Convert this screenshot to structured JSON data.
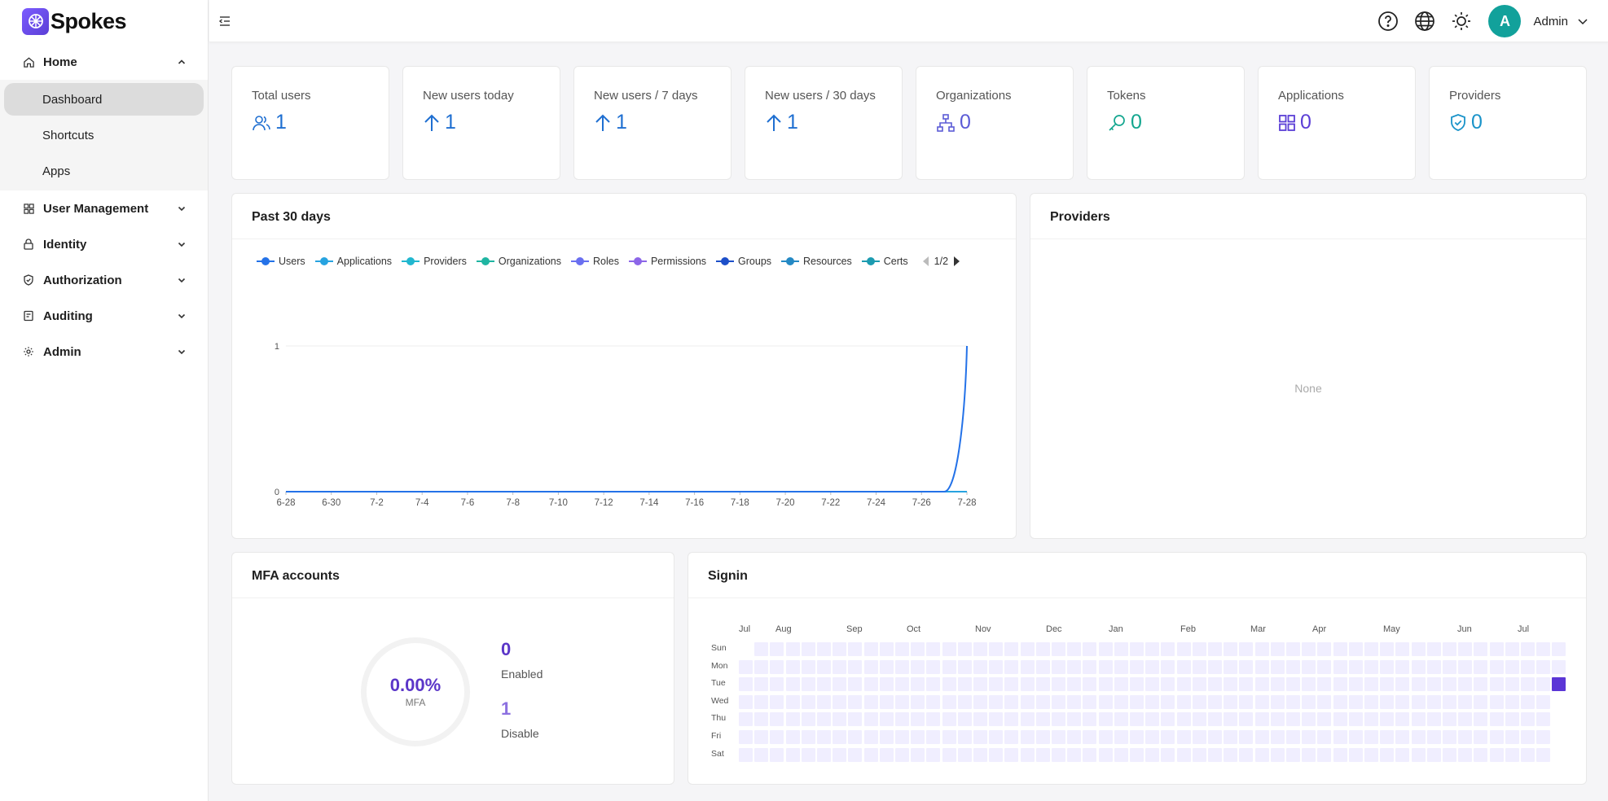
{
  "app": {
    "name": "Spokes"
  },
  "sidebar": {
    "home": {
      "label": "Home",
      "items": [
        {
          "label": "Dashboard",
          "active": true
        },
        {
          "label": "Shortcuts"
        },
        {
          "label": "Apps"
        }
      ]
    },
    "groups": [
      {
        "label": "User Management",
        "icon": "grid-icon"
      },
      {
        "label": "Identity",
        "icon": "lock-icon"
      },
      {
        "label": "Authorization",
        "icon": "shield-check-icon"
      },
      {
        "label": "Auditing",
        "icon": "audit-log-icon"
      },
      {
        "label": "Admin",
        "icon": "gear-icon"
      }
    ]
  },
  "header": {
    "user": {
      "initial": "A",
      "name": "Admin"
    },
    "avatar_color": "#12a19b"
  },
  "stats": [
    {
      "title": "Total users",
      "value": "1",
      "icon": "users-icon",
      "color": "#1f6fd1"
    },
    {
      "title": "New users today",
      "value": "1",
      "icon": "arrow-up-icon",
      "color": "#1f6fd1"
    },
    {
      "title": "New users / 7 days",
      "value": "1",
      "icon": "arrow-up-icon",
      "color": "#1f6fd1"
    },
    {
      "title": "New users / 30 days",
      "value": "1",
      "icon": "arrow-up-icon",
      "color": "#1f6fd1"
    },
    {
      "title": "Organizations",
      "value": "0",
      "icon": "org-tree-icon",
      "color": "#5b5bd6"
    },
    {
      "title": "Tokens",
      "value": "0",
      "icon": "key-icon",
      "color": "#13a68f"
    },
    {
      "title": "Applications",
      "value": "0",
      "icon": "apps-grid-icon",
      "color": "#5b3fd6"
    },
    {
      "title": "Providers",
      "value": "0",
      "icon": "shield-check-icon",
      "color": "#1a93c9"
    }
  ],
  "past30": {
    "title": "Past 30 days",
    "legend": [
      {
        "name": "Users",
        "color": "#2472e8"
      },
      {
        "name": "Applications",
        "color": "#27a3e0"
      },
      {
        "name": "Providers",
        "color": "#21b7cf"
      },
      {
        "name": "Organizations",
        "color": "#1fb5a2"
      },
      {
        "name": "Roles",
        "color": "#6a6ff0"
      },
      {
        "name": "Permissions",
        "color": "#8c66e8"
      },
      {
        "name": "Groups",
        "color": "#1d4fc9"
      },
      {
        "name": "Resources",
        "color": "#2489c4"
      },
      {
        "name": "Certs",
        "color": "#1c9bb0"
      }
    ],
    "legend_page": "1/2"
  },
  "providers_panel": {
    "title": "Providers",
    "empty_text": "None"
  },
  "mfa": {
    "title": "MFA accounts",
    "percent": "0.00%",
    "percent_label": "MFA",
    "enabled_value": "0",
    "enabled_label": "Enabled",
    "disable_value": "1",
    "disable_label": "Disable",
    "enabled_color": "#5b36c8",
    "disable_color": "#8c70e0"
  },
  "signin": {
    "title": "Signin",
    "months": [
      "Jul",
      "Aug",
      "Sep",
      "Oct",
      "Nov",
      "Dec",
      "Jan",
      "Feb",
      "Mar",
      "Apr",
      "May",
      "Jun",
      "Jul"
    ],
    "days": [
      "Sun",
      "Mon",
      "Tue",
      "Wed",
      "Thu",
      "Fri",
      "Sat"
    ],
    "active_cell": {
      "week": 52,
      "day": "Tue",
      "count": 1
    }
  },
  "chart_data": {
    "type": "line",
    "x": [
      "6-28",
      "6-29",
      "6-30",
      "7-1",
      "7-2",
      "7-3",
      "7-4",
      "7-5",
      "7-6",
      "7-7",
      "7-8",
      "7-9",
      "7-10",
      "7-11",
      "7-12",
      "7-13",
      "7-14",
      "7-15",
      "7-16",
      "7-17",
      "7-18",
      "7-19",
      "7-20",
      "7-21",
      "7-22",
      "7-23",
      "7-24",
      "7-25",
      "7-26",
      "7-27",
      "7-28"
    ],
    "x_tick_labels": [
      "6-28",
      "6-30",
      "7-2",
      "7-4",
      "7-6",
      "7-8",
      "7-10",
      "7-12",
      "7-14",
      "7-16",
      "7-18",
      "7-20",
      "7-22",
      "7-24",
      "7-26",
      "7-28"
    ],
    "y_tick_labels": [
      "0",
      "1"
    ],
    "ylim": [
      0,
      1
    ],
    "grid": true,
    "legend_position": "top",
    "series": [
      {
        "name": "Users",
        "values": [
          0,
          0,
          0,
          0,
          0,
          0,
          0,
          0,
          0,
          0,
          0,
          0,
          0,
          0,
          0,
          0,
          0,
          0,
          0,
          0,
          0,
          0,
          0,
          0,
          0,
          0,
          0,
          0,
          0,
          0,
          1
        ]
      },
      {
        "name": "Applications",
        "values": [
          0,
          0,
          0,
          0,
          0,
          0,
          0,
          0,
          0,
          0,
          0,
          0,
          0,
          0,
          0,
          0,
          0,
          0,
          0,
          0,
          0,
          0,
          0,
          0,
          0,
          0,
          0,
          0,
          0,
          0,
          0
        ]
      },
      {
        "name": "Providers",
        "values": [
          0,
          0,
          0,
          0,
          0,
          0,
          0,
          0,
          0,
          0,
          0,
          0,
          0,
          0,
          0,
          0,
          0,
          0,
          0,
          0,
          0,
          0,
          0,
          0,
          0,
          0,
          0,
          0,
          0,
          0,
          0
        ]
      },
      {
        "name": "Organizations",
        "values": [
          0,
          0,
          0,
          0,
          0,
          0,
          0,
          0,
          0,
          0,
          0,
          0,
          0,
          0,
          0,
          0,
          0,
          0,
          0,
          0,
          0,
          0,
          0,
          0,
          0,
          0,
          0,
          0,
          0,
          0,
          0
        ]
      },
      {
        "name": "Roles",
        "values": [
          0,
          0,
          0,
          0,
          0,
          0,
          0,
          0,
          0,
          0,
          0,
          0,
          0,
          0,
          0,
          0,
          0,
          0,
          0,
          0,
          0,
          0,
          0,
          0,
          0,
          0,
          0,
          0,
          0,
          0,
          0
        ]
      },
      {
        "name": "Permissions",
        "values": [
          0,
          0,
          0,
          0,
          0,
          0,
          0,
          0,
          0,
          0,
          0,
          0,
          0,
          0,
          0,
          0,
          0,
          0,
          0,
          0,
          0,
          0,
          0,
          0,
          0,
          0,
          0,
          0,
          0,
          0,
          0
        ]
      },
      {
        "name": "Groups",
        "values": [
          0,
          0,
          0,
          0,
          0,
          0,
          0,
          0,
          0,
          0,
          0,
          0,
          0,
          0,
          0,
          0,
          0,
          0,
          0,
          0,
          0,
          0,
          0,
          0,
          0,
          0,
          0,
          0,
          0,
          0,
          0
        ]
      },
      {
        "name": "Resources",
        "values": [
          0,
          0,
          0,
          0,
          0,
          0,
          0,
          0,
          0,
          0,
          0,
          0,
          0,
          0,
          0,
          0,
          0,
          0,
          0,
          0,
          0,
          0,
          0,
          0,
          0,
          0,
          0,
          0,
          0,
          0,
          0
        ]
      },
      {
        "name": "Certs",
        "values": [
          0,
          0,
          0,
          0,
          0,
          0,
          0,
          0,
          0,
          0,
          0,
          0,
          0,
          0,
          0,
          0,
          0,
          0,
          0,
          0,
          0,
          0,
          0,
          0,
          0,
          0,
          0,
          0,
          0,
          0,
          0
        ]
      }
    ]
  }
}
